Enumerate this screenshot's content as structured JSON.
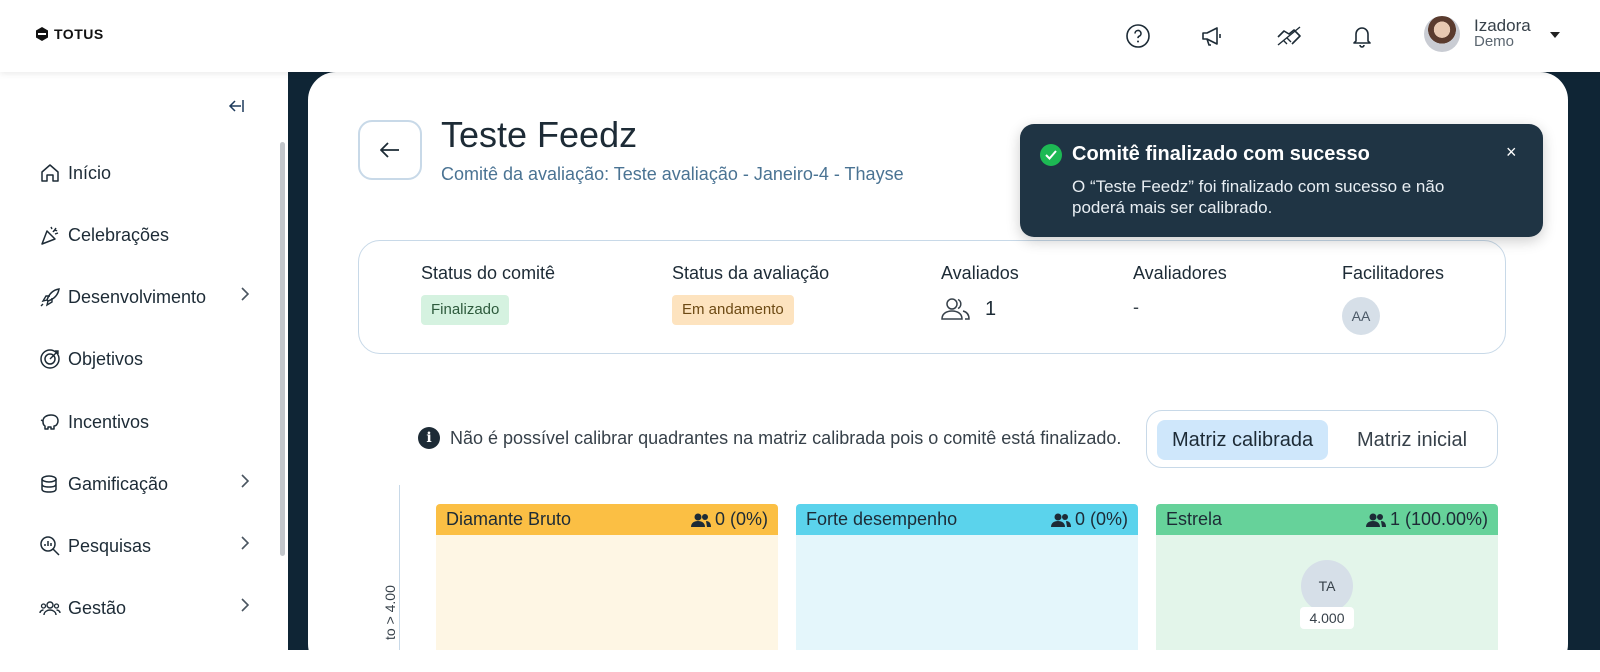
{
  "header": {
    "brand": "TOTUS",
    "user_name": "Izadora",
    "user_role": "Demo",
    "icons": [
      "help-icon",
      "megaphone-icon",
      "handshake-icon",
      "bell-icon"
    ]
  },
  "sidebar": {
    "items": [
      {
        "label": "Início",
        "icon": "home-icon",
        "has_submenu": false
      },
      {
        "label": "Celebrações",
        "icon": "party-icon",
        "has_submenu": false
      },
      {
        "label": "Desenvolvimento",
        "icon": "rocket-icon",
        "has_submenu": true
      },
      {
        "label": "Objetivos",
        "icon": "target-icon",
        "has_submenu": false
      },
      {
        "label": "Incentivos",
        "icon": "piggy-bank-icon",
        "has_submenu": false
      },
      {
        "label": "Gamificação",
        "icon": "coins-icon",
        "has_submenu": true
      },
      {
        "label": "Pesquisas",
        "icon": "chart-search-icon",
        "has_submenu": true
      },
      {
        "label": "Gestão",
        "icon": "team-icon",
        "has_submenu": true
      }
    ]
  },
  "page": {
    "title": "Teste Feedz",
    "subtitle": "Comitê da avaliação: Teste avaliação - Janeiro-4 - Thayse"
  },
  "status": {
    "committee_label": "Status do comitê",
    "committee_value": "Finalizado",
    "evaluation_label": "Status da avaliação",
    "evaluation_value": "Em andamento",
    "evaluated_label": "Avaliados",
    "evaluated_count": "1",
    "evaluators_label": "Avaliadores",
    "evaluators_value": "-",
    "facilitators_label": "Facilitadores",
    "facilitator_initials": "AA"
  },
  "matrix": {
    "info_text": "Não é possível calibrar quadrantes na matriz calibrada pois o comitê está finalizado.",
    "toggle_calibrated": "Matriz calibrada",
    "toggle_initial": "Matriz inicial",
    "y_axis_label": "to > 4.00",
    "quadrants": [
      {
        "name": "Diamante Bruto",
        "count": "0 (0%)",
        "header_color": "#fbbf44",
        "body_color": "#fef6e4"
      },
      {
        "name": "Forte desempenho",
        "count": "0 (0%)",
        "header_color": "#5bd3ec",
        "body_color": "#e4f6fb"
      },
      {
        "name": "Estrela",
        "count": "1 (100.00%)",
        "header_color": "#66d29a",
        "body_color": "#e3f5ea"
      }
    ],
    "member": {
      "initials": "TA",
      "score": "4.000"
    }
  },
  "toast": {
    "title": "Comitê finalizado com sucesso",
    "message": "O “Teste Feedz” foi finalizado com sucesso e não poderá mais ser calibrado.",
    "close": "×"
  }
}
